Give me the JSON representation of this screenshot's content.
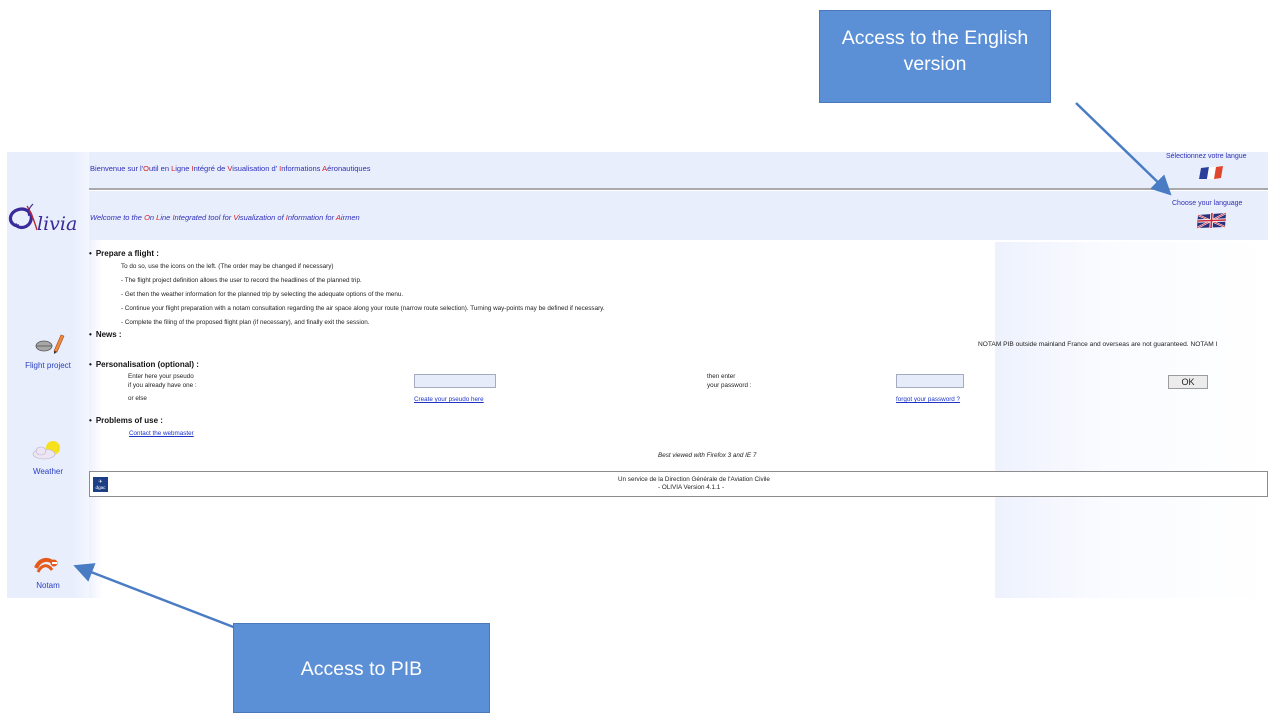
{
  "header": {
    "fr_welcome_parts": [
      "Bienvenue sur l'",
      "O",
      "util en ",
      "L",
      "igne ",
      "I",
      "ntégré de ",
      "V",
      "isualisation d' ",
      "I",
      "nformations ",
      "A",
      "éronautiques"
    ],
    "en_welcome_parts": [
      "Welcome to the ",
      "O",
      "n ",
      "L",
      "ine ",
      "I",
      "ntegrated tool for ",
      "V",
      "isualization of ",
      "I",
      "nformation for ",
      "A",
      "irmen"
    ],
    "lang_select_fr": "Sélectionnez votre langue",
    "lang_select_en": "Choose your language"
  },
  "logo": {
    "text": "livia"
  },
  "nav": {
    "flight_project": "Flight project",
    "weather": "Weather",
    "notam": "Notam"
  },
  "prepare": {
    "title": "Prepare a flight :",
    "intro": "To do so, use the icons on the left. (The order may be changed if necessary)",
    "steps": [
      "-   The flight project definition allows the user to record the headlines of the planned trip.",
      "-   Get then the weather information for the planned trip by selecting the adequate options of the menu.",
      "-   Continue your flight preparation with a notam consultation regarding the air space along your route (narrow route selection). Turning way-points may be defined if necessary.",
      "-   Complete the filing of the proposed flight plan (if necessary), and finally exit the session."
    ]
  },
  "news": {
    "title": "News :",
    "notice": "NOTAM PIB outside mainland France and overseas are not guaranteed. NOTAM I"
  },
  "personalisation": {
    "title": "Personalisation (optional) :",
    "pseudo_line1": "Enter here your pseudo",
    "pseudo_line2": "if you already have one :",
    "or_else": "or else",
    "create_link": "Create your pseudo here",
    "then_enter": "then enter",
    "your_password": "your password :",
    "forgot_link": "forgot your password ?",
    "ok_label": "OK"
  },
  "problems": {
    "title": "Problems of use :",
    "contact_link": "Contact the webmaster"
  },
  "best_viewed": "Best viewed with Firefox 3 and IE 7",
  "footer": {
    "logo_text": "dgac",
    "line1": "Un service de la Direction Générale de l'Aviation Civile",
    "line2": "- OLIVIA Version 4.1.1 -"
  },
  "annotations": {
    "english_callout": "Access to the English version",
    "pib_callout": "Access to PIB"
  },
  "colors": {
    "panel_blue": "#e8eefc",
    "link_blue": "#1d33c8",
    "highlight_red": "#d81a1a",
    "callout_blue": "#5b8fd6"
  }
}
